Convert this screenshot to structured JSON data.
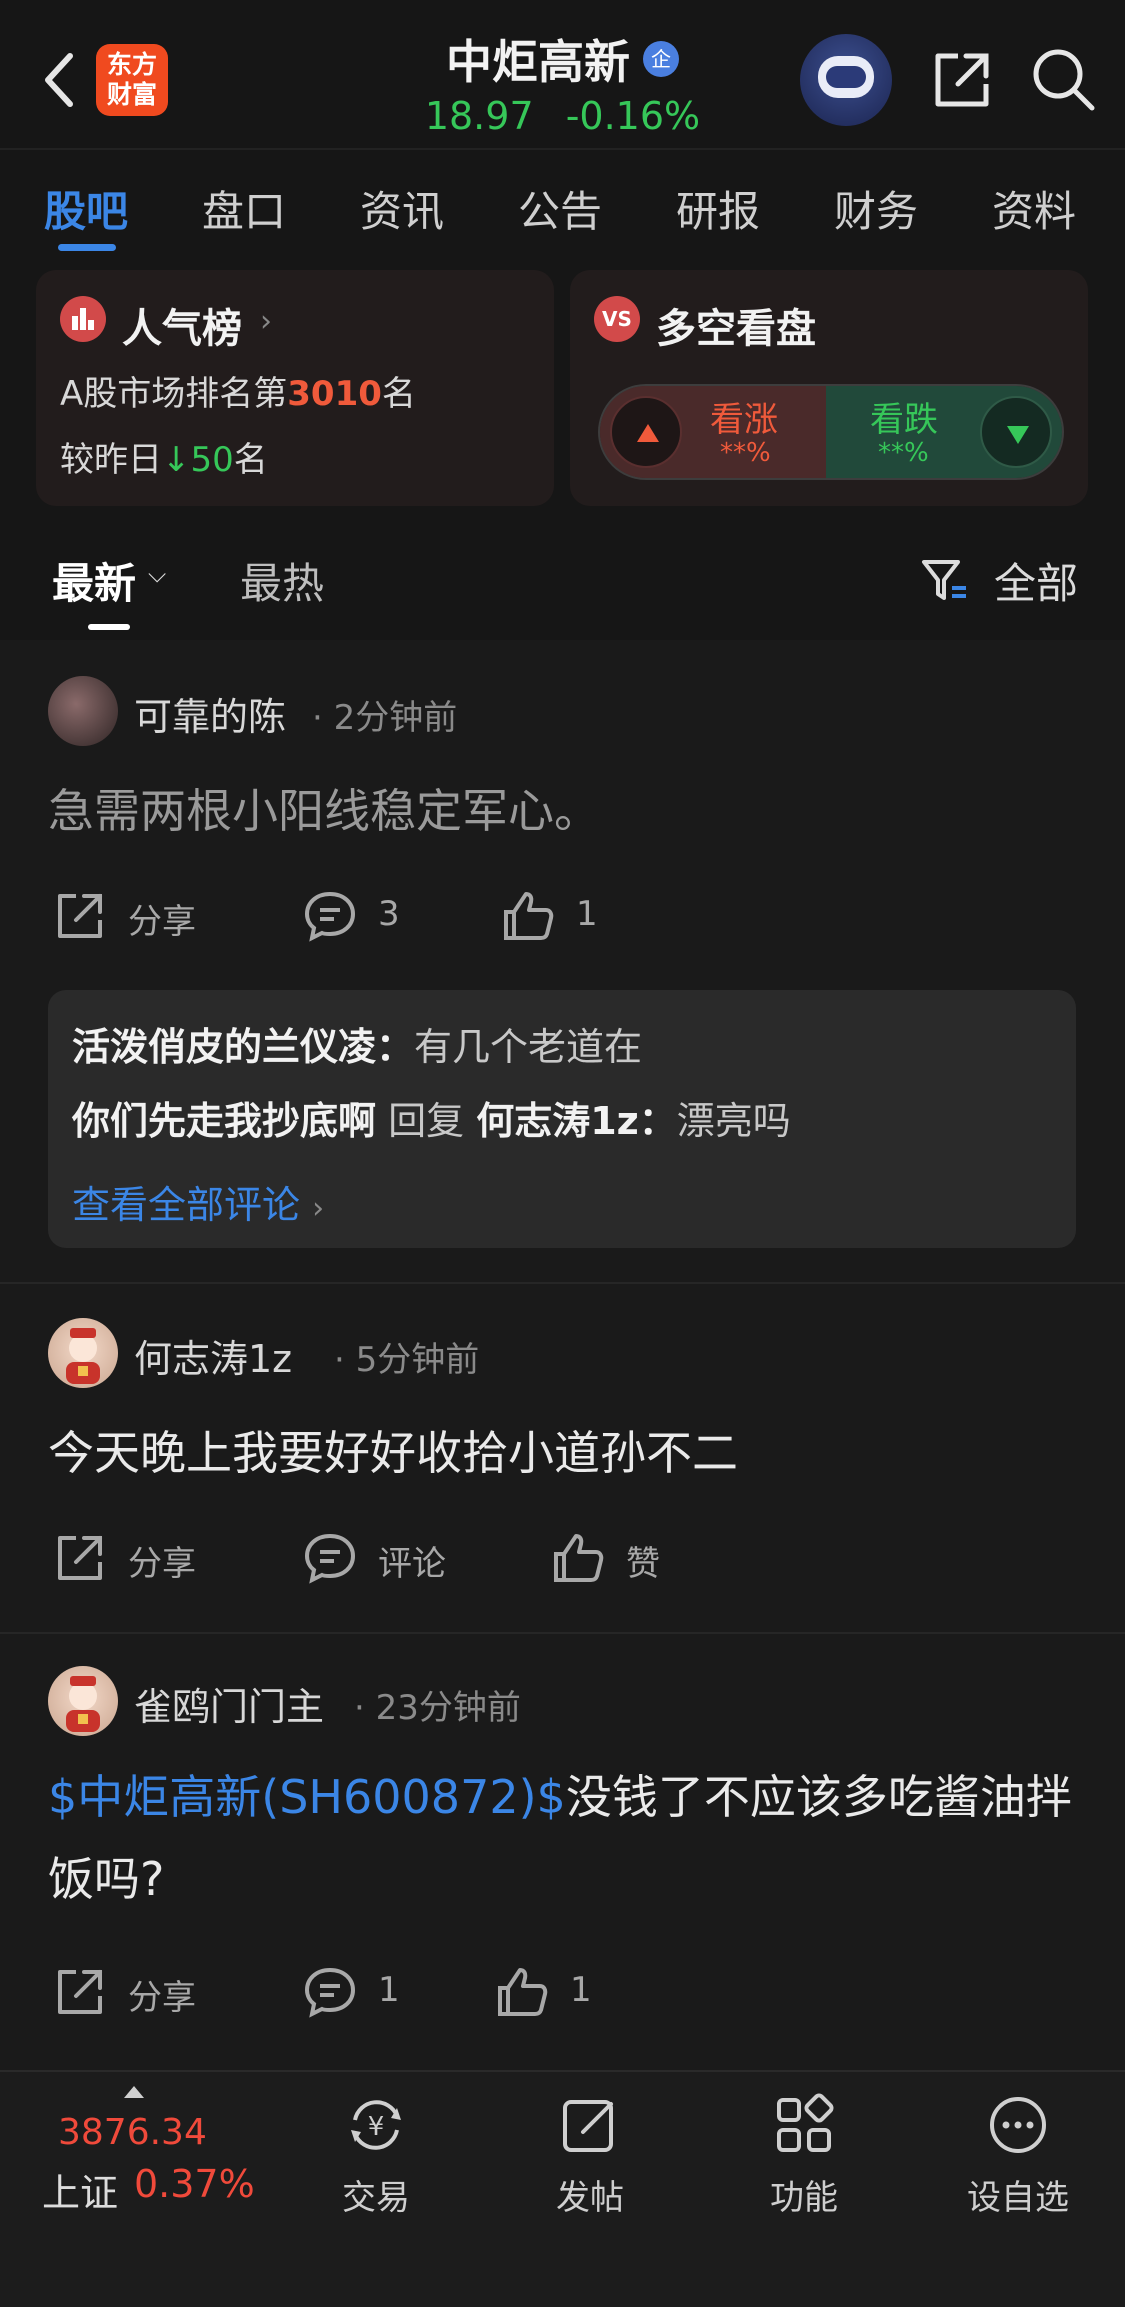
{
  "header": {
    "logo_text_line1": "东方",
    "logo_text_line2": "财富",
    "title": "中炬高新",
    "badge": "企",
    "price": "18.97",
    "change": "-0.16%"
  },
  "tabs": [
    {
      "label": "股吧",
      "active": true
    },
    {
      "label": "盘口"
    },
    {
      "label": "资讯"
    },
    {
      "label": "公告"
    },
    {
      "label": "研报"
    },
    {
      "label": "财务"
    },
    {
      "label": "资料"
    }
  ],
  "popularity_card": {
    "title": "人气榜",
    "rank_prefix": "A股市场排名第",
    "rank_value": "3010",
    "rank_suffix": "名",
    "change_prefix": "较昨日",
    "change_value": "50",
    "change_suffix": "名"
  },
  "sentiment_card": {
    "icon_text": "VS",
    "title": "多空看盘",
    "bull_label": "看涨",
    "bull_pct": "**%",
    "bear_label": "看跌",
    "bear_pct": "**%"
  },
  "filter": {
    "newest": "最新",
    "hot": "最热",
    "all": "全部"
  },
  "posts": [
    {
      "user": "可靠的陈",
      "time": "· 2分钟前",
      "text": "急需两根小阳线稳定军心。",
      "share": "分享",
      "comments": "3",
      "likes": "1",
      "replies": [
        {
          "author": "活泼俏皮的兰仪凌：",
          "text": "有几个老道在"
        },
        {
          "author": "你们先走我抄底啊",
          "mid": " 回复 ",
          "author2": "何志涛1z：",
          "text": "漂亮吗"
        }
      ],
      "view_all": "查看全部评论"
    },
    {
      "user": "何志涛1z",
      "time": "· 5分钟前",
      "text": "今天晚上我要好好收拾小道孙不二",
      "share": "分享",
      "comments": "评论",
      "likes": "赞"
    },
    {
      "user": "雀鸥门门主",
      "time": "· 23分钟前",
      "link": "$中炬高新(SH600872)$",
      "text": "没钱了不应该多吃酱油拌饭吗?",
      "share": "分享",
      "comments": "1",
      "likes": "1"
    }
  ],
  "bottom_bar": {
    "index_value": "3876.34",
    "index_name": "上证",
    "index_pct": "0.37%",
    "items": [
      "交易",
      "发帖",
      "功能",
      "设自选"
    ]
  },
  "colors": {
    "accent_blue": "#3b86e6",
    "up_red": "#f04a3b",
    "down_green": "#36c759",
    "background": "#161616"
  }
}
